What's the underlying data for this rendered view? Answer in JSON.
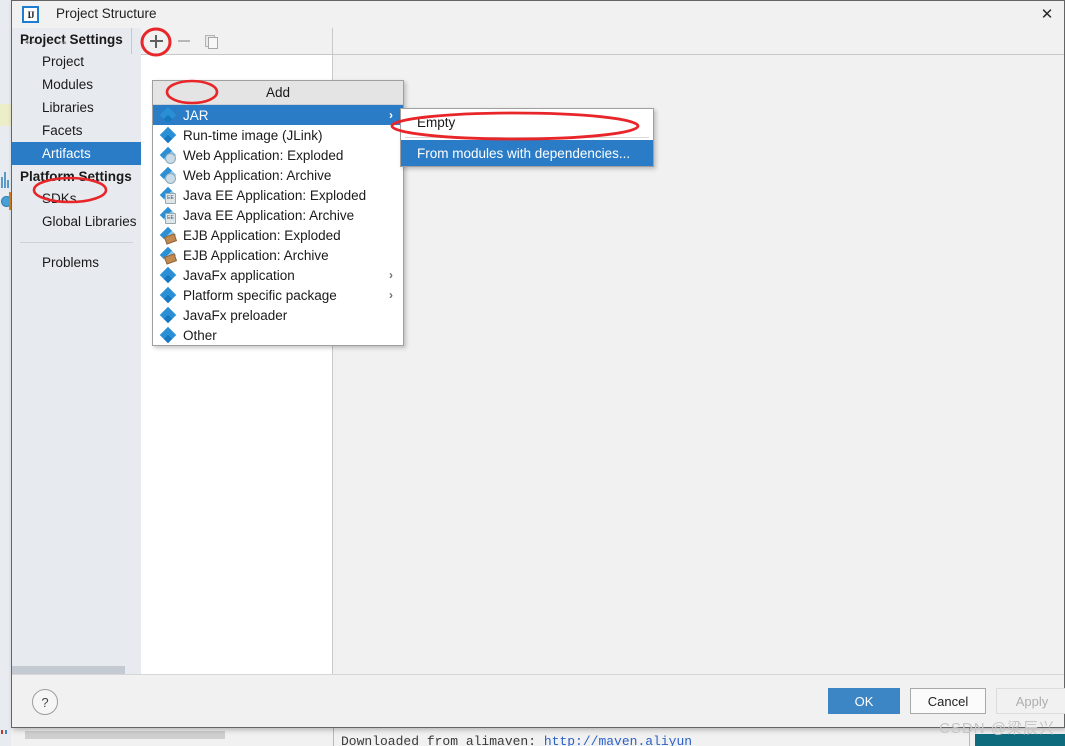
{
  "window": {
    "title": "Project Structure",
    "app_icon_text": "IJ",
    "close_icon": "close-icon"
  },
  "sidebar": {
    "groups": [
      {
        "label": "Project Settings",
        "items": [
          {
            "label": "Project",
            "selected": false
          },
          {
            "label": "Modules",
            "selected": false
          },
          {
            "label": "Libraries",
            "selected": false
          },
          {
            "label": "Facets",
            "selected": false
          },
          {
            "label": "Artifacts",
            "selected": true
          }
        ]
      },
      {
        "label": "Platform Settings",
        "items": [
          {
            "label": "SDKs",
            "selected": false
          },
          {
            "label": "Global Libraries",
            "selected": false
          }
        ]
      }
    ],
    "extra_items": [
      {
        "label": "Problems",
        "selected": false
      }
    ]
  },
  "toolbar": {
    "back_icon": "←",
    "forward_icon": "→",
    "add_title": "Add artifact",
    "remove_title": "Remove artifact",
    "copy_title": "Copy artifact"
  },
  "add_menu": {
    "header": "Add",
    "items": [
      {
        "label": "JAR",
        "selected": true,
        "submenu": true,
        "icon": "jar-icon"
      },
      {
        "label": "Run-time image (JLink)",
        "selected": false,
        "submenu": false,
        "icon": "runtime-image-icon"
      },
      {
        "label": "Web Application: Exploded",
        "selected": false,
        "submenu": false,
        "icon": "web-app-exploded-icon"
      },
      {
        "label": "Web Application: Archive",
        "selected": false,
        "submenu": false,
        "icon": "web-app-archive-icon"
      },
      {
        "label": "Java EE Application: Exploded",
        "selected": false,
        "submenu": false,
        "icon": "javaee-exploded-icon"
      },
      {
        "label": "Java EE Application: Archive",
        "selected": false,
        "submenu": false,
        "icon": "javaee-archive-icon"
      },
      {
        "label": "EJB Application: Exploded",
        "selected": false,
        "submenu": false,
        "icon": "ejb-exploded-icon"
      },
      {
        "label": "EJB Application: Archive",
        "selected": false,
        "submenu": false,
        "icon": "ejb-archive-icon"
      },
      {
        "label": "JavaFx application",
        "selected": false,
        "submenu": true,
        "icon": "javafx-app-icon"
      },
      {
        "label": "Platform specific package",
        "selected": false,
        "submenu": true,
        "icon": "platform-package-icon"
      },
      {
        "label": "JavaFx preloader",
        "selected": false,
        "submenu": false,
        "icon": "javafx-preloader-icon"
      },
      {
        "label": "Other",
        "selected": false,
        "submenu": false,
        "icon": "other-icon"
      }
    ],
    "submenu_arrow": "❯"
  },
  "jar_submenu": {
    "items": [
      {
        "label": "Empty",
        "selected": false
      },
      {
        "label": "From modules with dependencies...",
        "selected": true
      }
    ]
  },
  "footer": {
    "help_label": "?",
    "ok_label": "OK",
    "cancel_label": "Cancel",
    "apply_label": "Apply"
  },
  "background": {
    "console_prefix": "Downloaded from alimaven: ",
    "console_url": "http://maven.aliyun"
  },
  "watermark": "CSDN @梁辰兴",
  "colors": {
    "accent_blue": "#2a7cc7",
    "ok_button": "#3d86c6",
    "annotation_red": "#e8262a",
    "sidebar_bg": "#e7ebef",
    "dialog_bg": "#f1f1f1"
  }
}
